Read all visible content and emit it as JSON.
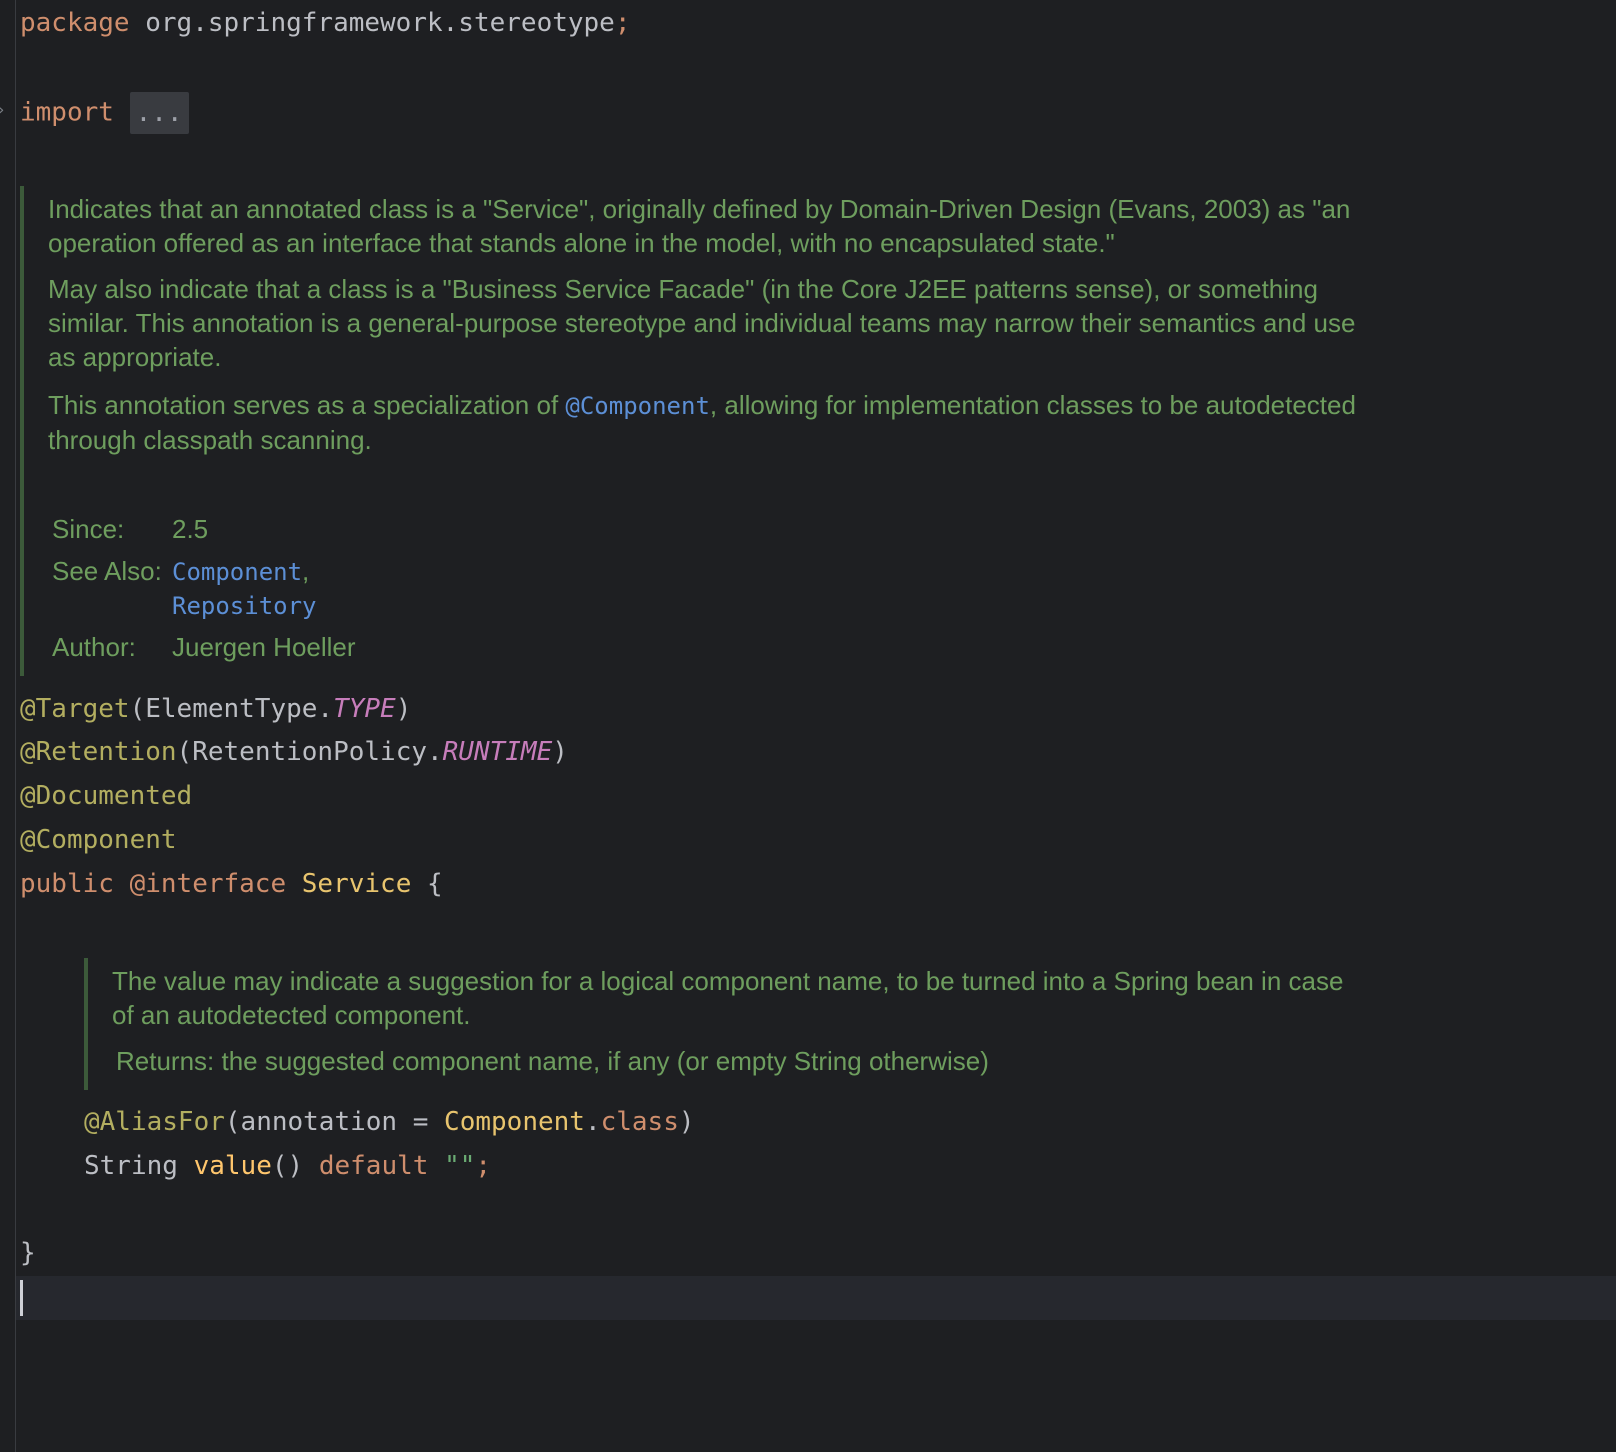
{
  "code": {
    "package_kw": "package",
    "package_name": " org.springframework.stereotype",
    "semicolon": ";",
    "import_kw": "import",
    "import_fold": "...",
    "ann_target": "@Target",
    "target_open": "(ElementType.",
    "target_const": "TYPE",
    "close_paren": ")",
    "ann_retention": "@Retention",
    "retention_open": "(RetentionPolicy.",
    "retention_const": "RUNTIME",
    "ann_documented": "@Documented",
    "ann_component": "@Component",
    "public_kw": "public",
    "interface_kw": "@interface",
    "class_name": "Service",
    "open_brace": "{",
    "ann_aliasfor": "@AliasFor",
    "alias_open": "(annotation = ",
    "alias_class": "Component",
    "alias_dot": ".",
    "class_kw": "class",
    "string_type": "String",
    "value_fn": "value",
    "parens": "()",
    "default_kw": "default",
    "empty_str": "\"\"",
    "close_brace": "}"
  },
  "doc_class": {
    "p1": "Indicates that an annotated class is a \"Service\", originally defined by Domain-Driven Design (Evans, 2003) as \"an operation offered as an interface that stands alone in the model, with no encapsulated state.\"",
    "p2": "May also indicate that a class is a \"Business Service Facade\" (in the Core J2EE patterns sense), or something similar. This annotation is a general-purpose stereotype and individual teams may narrow their semantics and use as appropriate.",
    "p3_before": "This annotation serves as a specialization of ",
    "p3_link": "@Component",
    "p3_after": ", allowing for implementation classes to be autodetected through classpath scanning.",
    "since_label": "Since:",
    "since_value": "2.5",
    "see_also_label": "See Also:",
    "see_also_link1": "Component",
    "see_also_comma": ",",
    "see_also_link2": "Repository",
    "author_label": "Author:",
    "author_value": "Juergen Hoeller"
  },
  "doc_method": {
    "p1": "The value may indicate a suggestion for a logical component name, to be turned into a Spring bean in case of an autodetected component.",
    "returns": "Returns: the suggested component name, if any (or empty String otherwise)"
  },
  "colors": {
    "background": "#1e1f22",
    "keyword": "#cf8e6d",
    "annotation": "#b3ae60",
    "doc_text": "#6e9e5e",
    "doc_link": "#5c8fd6",
    "constant": "#c77dbb"
  }
}
